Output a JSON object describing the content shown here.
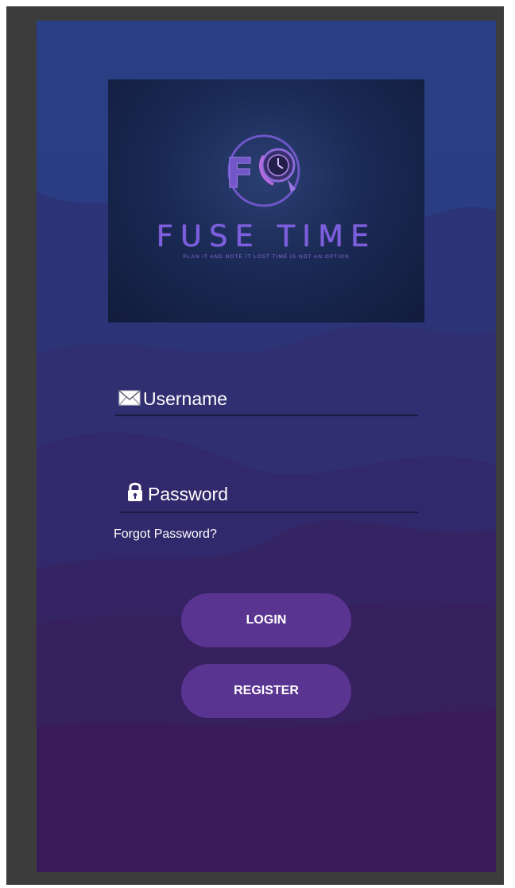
{
  "app": {
    "brand_name": "FUSE TIME",
    "tagline": "PLAN IT AND NOTE IT LOST TIME IS NOT AN OPTION",
    "logo_monogram": "F"
  },
  "form": {
    "username_placeholder": "Username",
    "username_icon": "mail-icon",
    "password_placeholder": "Password",
    "password_icon": "lock-icon",
    "forgot_password": "Forgot Password?"
  },
  "actions": {
    "login_label": "LOGIN",
    "register_label": "REGISTER"
  },
  "colors": {
    "background_top": "#2a3d80",
    "background_bottom": "#3b1a58",
    "button": "#5a3491",
    "logo_accent": "#7a5fe0"
  }
}
